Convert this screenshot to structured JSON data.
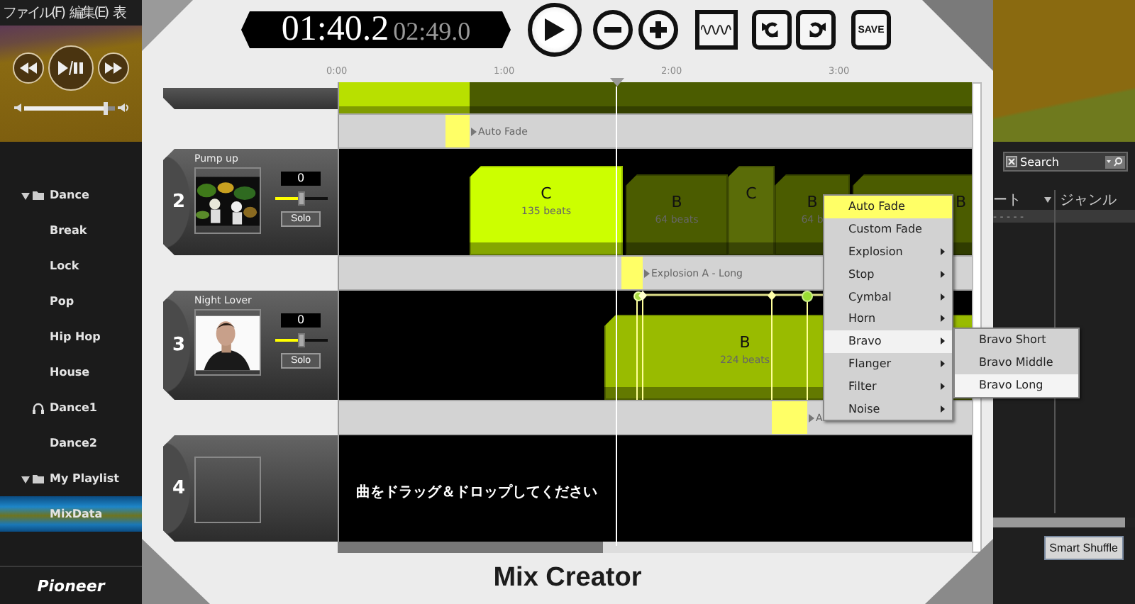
{
  "app": {
    "menu": [
      "ファイル(F)",
      "編集(E)",
      "表"
    ],
    "player": {
      "volume": {
        "level": 0.92
      }
    },
    "library": [
      {
        "label": "Dance",
        "kind": "folder",
        "expanded": true,
        "selected": false,
        "children": [
          {
            "label": "Break",
            "selected": false
          },
          {
            "label": "Lock",
            "selected": false
          },
          {
            "label": "Pop",
            "selected": false
          },
          {
            "label": "Hip Hop",
            "selected": false
          },
          {
            "label": "House",
            "selected": false
          }
        ]
      },
      {
        "label": "Dance1",
        "kind": "headphones",
        "selected": false
      },
      {
        "label": "Dance2",
        "selected": false
      },
      {
        "label": "My Playlist",
        "kind": "folder",
        "expanded": true,
        "selected": false,
        "children": [
          {
            "label": "MixData",
            "selected": true
          }
        ]
      }
    ],
    "logo": "Pioneer",
    "search": {
      "placeholder": "Search"
    },
    "columns": [
      {
        "label": "ート"
      },
      {
        "label": "ジャンル"
      }
    ],
    "rows": [
      [
        "- - - - -"
      ]
    ],
    "button": "Smart Shuffle"
  },
  "mix_creator": {
    "elapsed": "01:40.2",
    "total": "02:49.0",
    "toolbar": [
      {
        "kind": "play"
      },
      {
        "kind": "minus"
      },
      {
        "kind": "plus"
      },
      {
        "kind": "waveform"
      },
      {
        "kind": "undo"
      },
      {
        "kind": "redo"
      },
      {
        "kind": "save",
        "label": "SAVE"
      }
    ],
    "ruler": [
      "0:00",
      "1:00",
      "2:00",
      "3:00"
    ],
    "rows": [
      {
        "kind": "track_partial"
      },
      {
        "kind": "transition",
        "label": "Auto Fade"
      },
      {
        "kind": "track",
        "number": "2",
        "title": "Pump up",
        "thumbnail": {
          "kind": "picture"
        },
        "volume": "0",
        "fader": {
          "level": 0.5
        },
        "solo": "Solo",
        "clips": [
          {
            "name": "C",
            "beats": "135 beats",
            "color": "#ccff00"
          },
          {
            "name": "B",
            "beats": "64 beats",
            "color": "#4b5c00"
          },
          {
            "name": "C",
            "color": "#5a6c08"
          },
          {
            "name": "B",
            "beats": "64 b",
            "color": "#4b5c00"
          },
          {
            "name": "B",
            "color": "#4b5c00"
          }
        ]
      },
      {
        "kind": "transition",
        "label": "Explosion A - Long"
      },
      {
        "kind": "track",
        "number": "3",
        "title": "Night Lover",
        "thumbnail": {
          "kind": "picture"
        },
        "volume": "0",
        "fader": {
          "level": 0.5
        },
        "solo": "Solo",
        "clips": [
          {
            "name": "B",
            "beats": "224 beats",
            "color": "#99bb00"
          }
        ]
      },
      {
        "kind": "transition",
        "label": "A"
      },
      {
        "kind": "empty_track",
        "number": "4",
        "hint": "曲をドラッグ＆ドロップしてください"
      }
    ],
    "title": "Mix Creator"
  },
  "context_menu": {
    "items": [
      {
        "label": "Auto Fade",
        "selected": true,
        "submenu": false,
        "open": false
      },
      {
        "label": "Custom Fade",
        "selected": false,
        "submenu": false,
        "open": false
      },
      {
        "label": "Explosion",
        "selected": false,
        "submenu": true,
        "open": false
      },
      {
        "label": "Stop",
        "selected": false,
        "submenu": true,
        "open": false
      },
      {
        "label": "Cymbal",
        "selected": false,
        "submenu": true,
        "open": false
      },
      {
        "label": "Horn",
        "selected": false,
        "submenu": true,
        "open": false
      },
      {
        "label": "Bravo",
        "selected": false,
        "submenu": true,
        "open": true,
        "children": [
          {
            "label": "Bravo Short",
            "selected": false
          },
          {
            "label": "Bravo Middle",
            "selected": false
          },
          {
            "label": "Bravo Long",
            "selected": true
          }
        ]
      },
      {
        "label": "Flanger",
        "selected": false,
        "submenu": true,
        "open": false
      },
      {
        "label": "Filter",
        "selected": false,
        "submenu": true,
        "open": false
      },
      {
        "label": "Noise",
        "selected": false,
        "submenu": true,
        "open": false
      }
    ]
  }
}
